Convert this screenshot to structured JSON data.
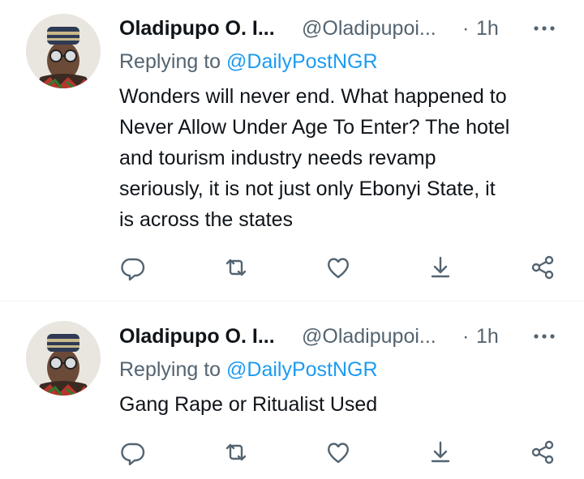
{
  "tweets": [
    {
      "name": "Oladipupo O. I...",
      "handle": "@Oladipupoi...",
      "dot": "·",
      "time": "1h",
      "replying_prefix": "Replying to",
      "replying_to": "@DailyPostNGR",
      "lines": [
        "Wonders will never end. What happened to",
        "Never Allow Under Age To Enter? The hotel",
        "and tourism industry needs revamp",
        "seriously, it is not just only Ebonyi State, it",
        "is across the states"
      ]
    },
    {
      "name": "Oladipupo O. I...",
      "handle": "@Oladipupoi...",
      "dot": "·",
      "time": "1h",
      "replying_prefix": "Replying to",
      "replying_to": "@DailyPostNGR",
      "lines": [
        "Gang Rape or Ritualist Used"
      ]
    }
  ],
  "icons": {
    "reply": "reply-icon",
    "retweet": "retweet-icon",
    "like": "like-icon",
    "share_down": "download-icon",
    "share": "share-icon",
    "more": "more-icon"
  },
  "colors": {
    "text": "#0f1419",
    "secondary": "#536471",
    "accent": "#1d9bf0",
    "divider": "#eff3f4"
  }
}
